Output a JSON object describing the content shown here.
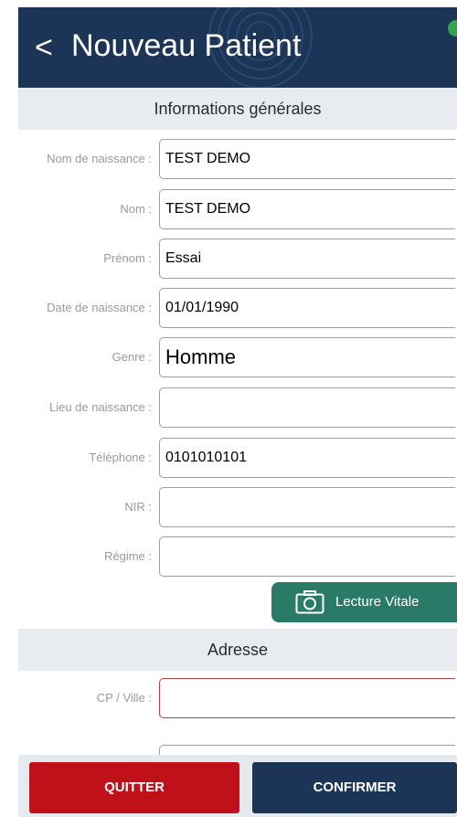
{
  "header": {
    "back_icon": "chevron-left-icon",
    "back_glyph": "<",
    "title": "Nouveau Patient",
    "status_color": "#2fa64a"
  },
  "sections": {
    "general": "Informations générales",
    "address": "Adresse"
  },
  "fields": [
    {
      "label": "Nom de naissance :",
      "value": "TEST DEMO"
    },
    {
      "label": "Nom :",
      "value": "TEST DEMO"
    },
    {
      "label": "Prénom :",
      "value": "Essai"
    },
    {
      "label": "Date de naissance :",
      "value": "01/01/1990"
    },
    {
      "label": "Genre :",
      "value": "Homme"
    },
    {
      "label": "Lieu de naissance :",
      "value": ""
    },
    {
      "label": "Téléphone :",
      "value": "0101010101"
    },
    {
      "label": "NIR :",
      "value": ""
    },
    {
      "label": "Régime :",
      "value": ""
    }
  ],
  "vitale_button": {
    "label": "Lecture Vitale",
    "icon": "camera-icon",
    "color": "#2a7a68"
  },
  "address_fields": [
    {
      "label": "CP / Ville :",
      "value": ""
    }
  ],
  "footer": {
    "quit_label": "QUITTER",
    "confirm_label": "CONFIRMER",
    "quit_color": "#c0101a",
    "confirm_color": "#1c3557"
  },
  "colors": {
    "header_bg": "#1c3557",
    "section_bg": "#e8ecf0",
    "error_border": "#b44040"
  }
}
